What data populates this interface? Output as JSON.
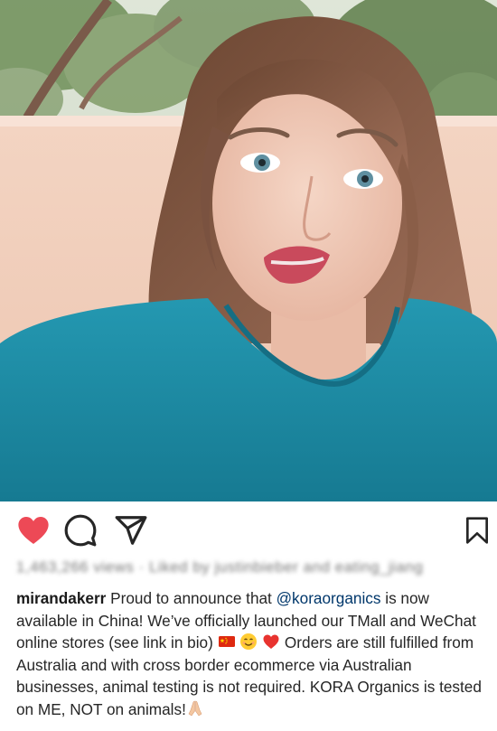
{
  "post": {
    "username": "mirandakerr",
    "mention": "@koraorganics",
    "caption_part1": " Proud to announce that ",
    "caption_part2": " is now available in China! We’ve officially launched our TMall and WeChat online stores (see link in bio) ",
    "caption_part3": " Orders are still fulfilled from Australia and with cross border ecommerce via Australian businesses, animal testing is not required. KORA Organics is tested on ME, NOT on animals!",
    "stats_blurred": "1,463,266 views · Liked by justinbieber and eating_jiang",
    "liked": true
  },
  "icons": {
    "like": "heart-icon",
    "comment": "comment-icon",
    "share": "paper-plane-icon",
    "save": "bookmark-icon",
    "emoji_flag": "china-flag-emoji",
    "emoji_smile": "smiling-face-emoji",
    "emoji_heart": "red-heart-emoji",
    "emoji_hands": "praying-hands-emoji"
  },
  "colors": {
    "like": "#ed4956",
    "text": "#262626",
    "mention": "#00376b",
    "shirt": "#1d8ca6"
  }
}
